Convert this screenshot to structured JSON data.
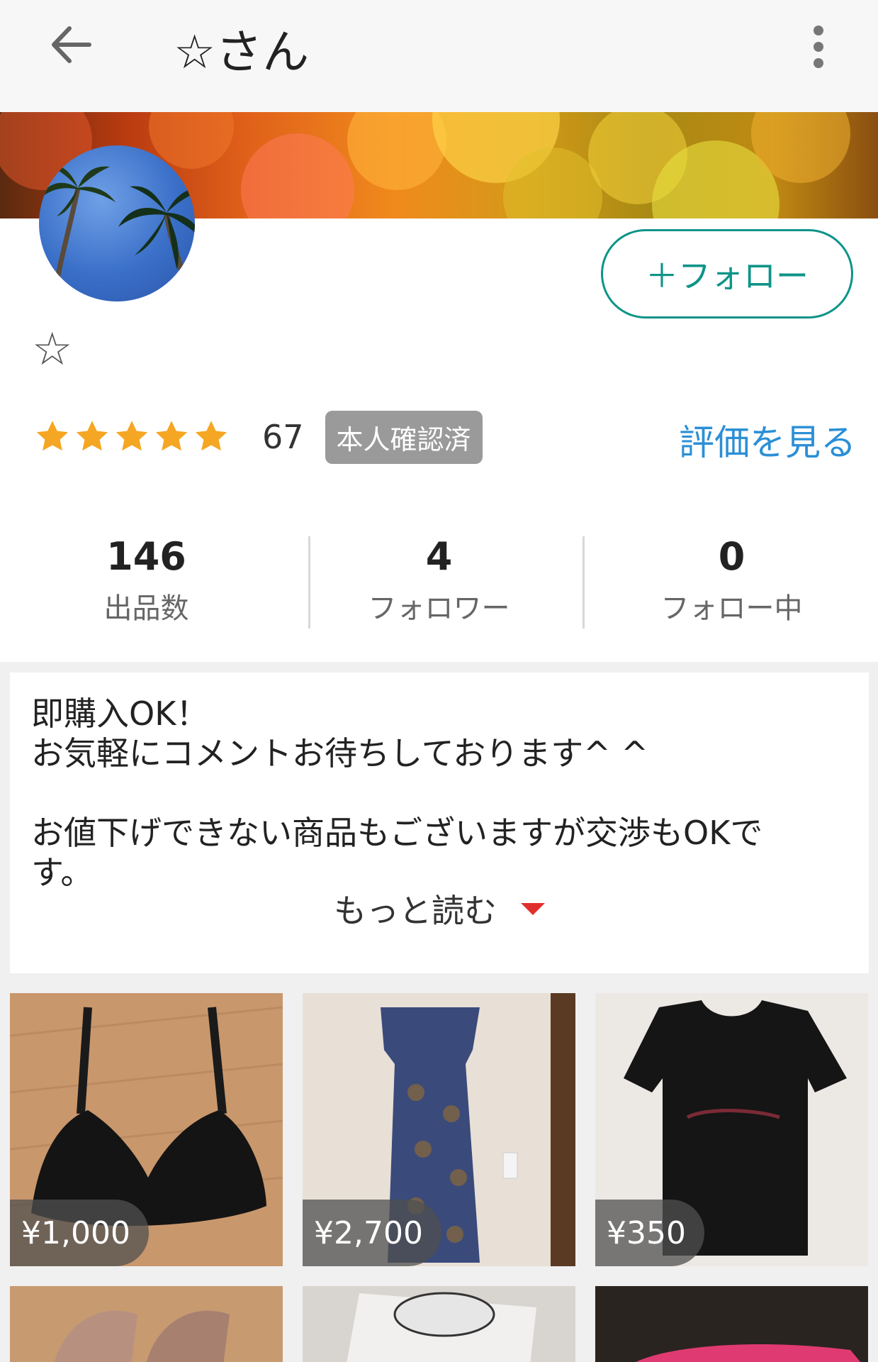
{
  "header": {
    "title": "☆さん"
  },
  "profile": {
    "name": "☆",
    "follow_label": "＋フォロー",
    "rating": {
      "stars": 5,
      "count": "67"
    },
    "verified_label": "本人確認済",
    "see_reviews_label": "評価を見る"
  },
  "stats": [
    {
      "value": "146",
      "label": "出品数"
    },
    {
      "value": "4",
      "label": "フォロワー"
    },
    {
      "value": "0",
      "label": "フォロー中"
    }
  ],
  "bio": {
    "text": "即購入OK！\nお気軽にコメントお待ちしております^ ^\n\nお値下げできない商品もございますが交渉もOKで\nす。",
    "read_more_label": "もっと読む"
  },
  "items": [
    {
      "price": "¥1,000"
    },
    {
      "price": "¥2,700"
    },
    {
      "price": "¥350"
    }
  ],
  "colors": {
    "accent": "#0e9488",
    "link": "#2b8fd6",
    "star": "#f5a623",
    "arrow": "#e0302e"
  }
}
